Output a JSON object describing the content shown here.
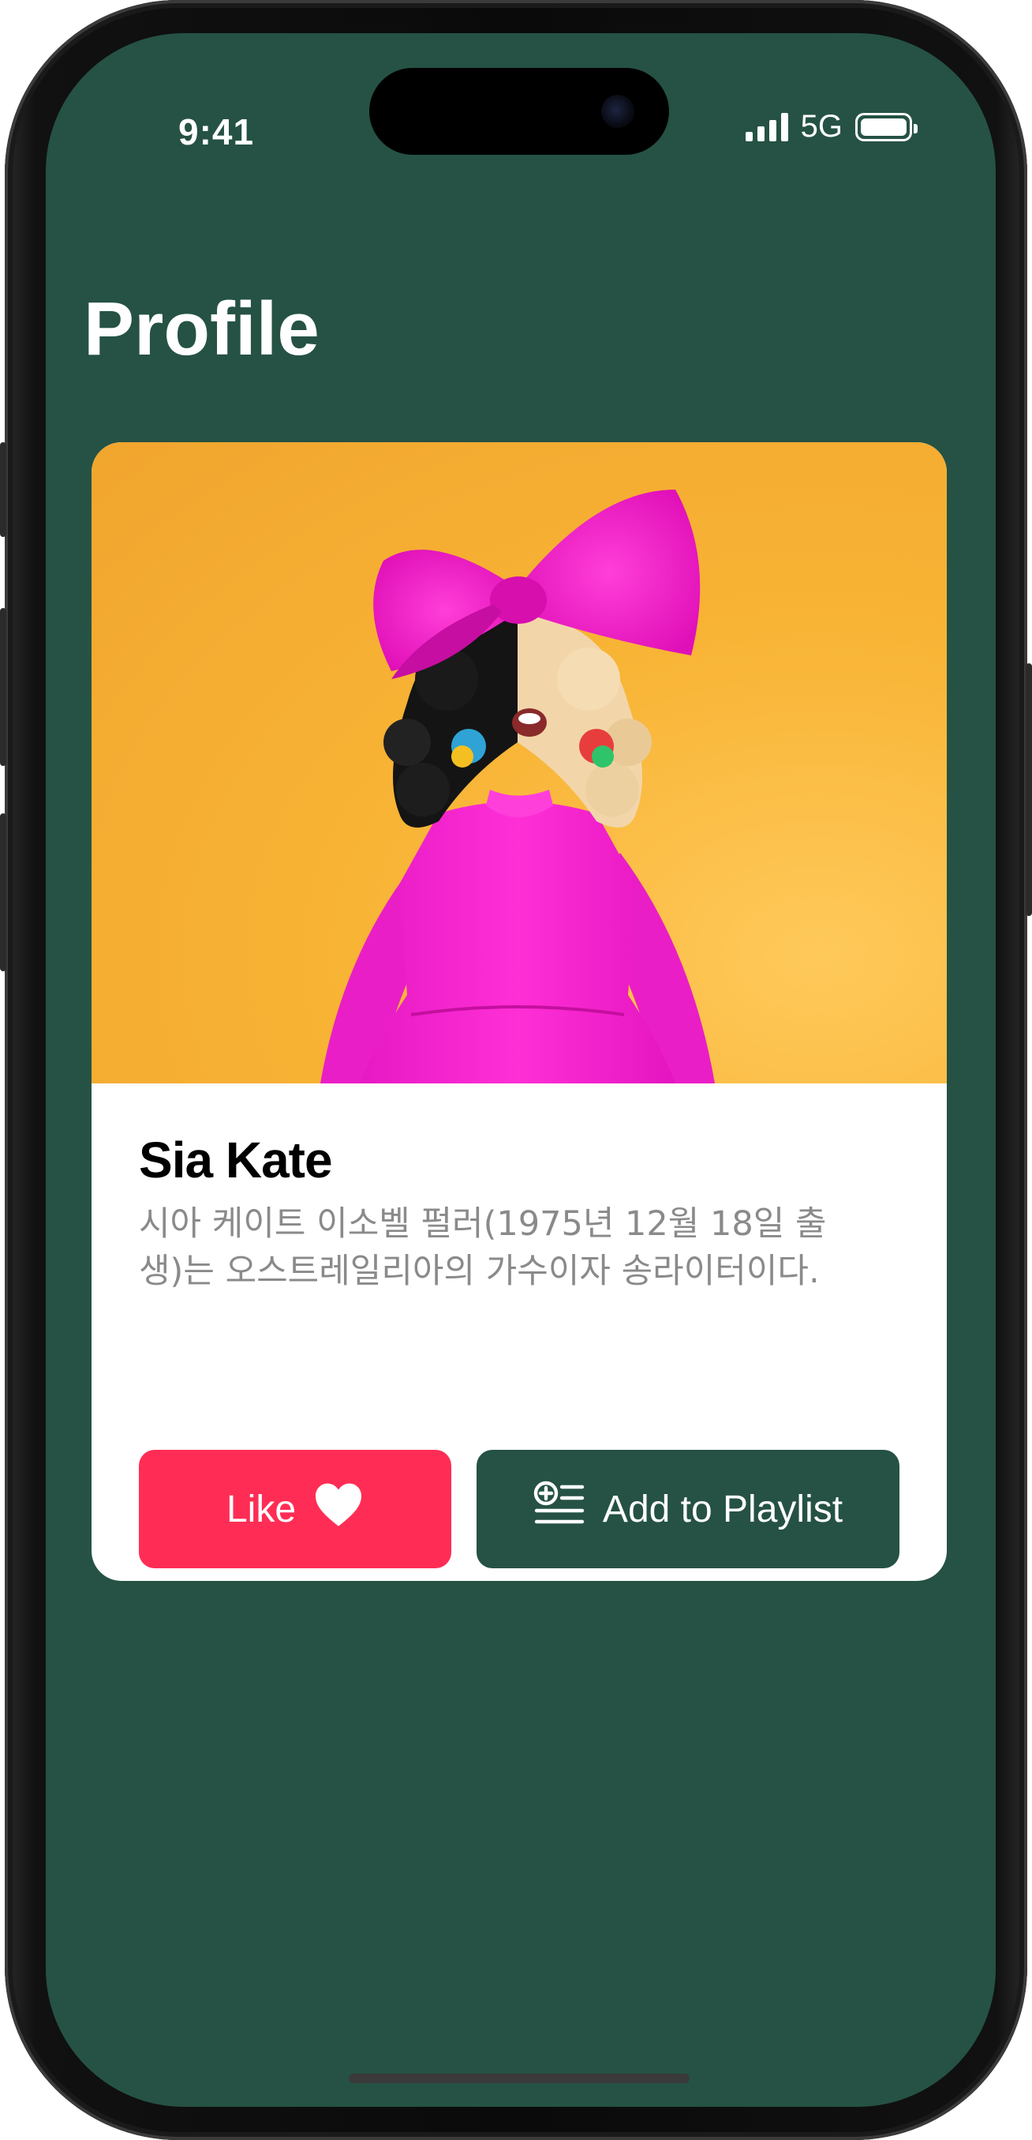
{
  "status_bar": {
    "time": "9:41",
    "network": "5G",
    "signal_icon": "cellular-signal-icon",
    "battery_icon": "battery-icon"
  },
  "page": {
    "title": "Profile"
  },
  "profile": {
    "name": "Sia Kate",
    "bio": "시아 케이트 이소벨 펄러(1975년 12월 18일 출생)는 오스트레일리아의 가수이자 송라이터이다.",
    "photo_icon": "artist-photo"
  },
  "actions": {
    "like_label": "Like",
    "like_icon": "heart-icon",
    "playlist_label": "Add to Playlist",
    "playlist_icon": "add-to-list-icon"
  },
  "colors": {
    "background": "#255244",
    "card": "#ffffff",
    "like_button": "#ff2d55",
    "playlist_button": "#255244",
    "bio_text": "#8a8a8a"
  }
}
